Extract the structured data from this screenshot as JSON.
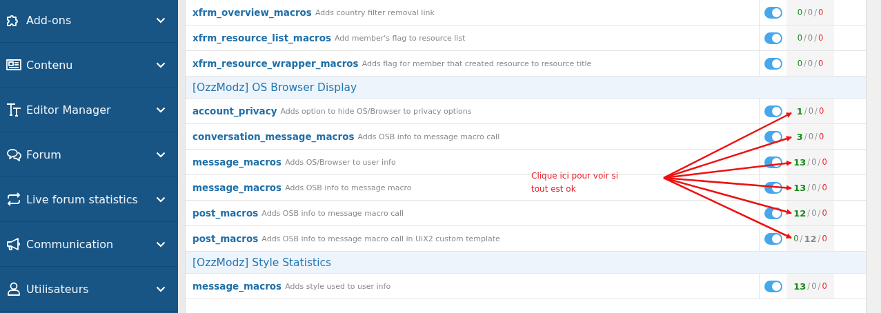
{
  "sidebar": {
    "items": [
      {
        "label": "Add-ons",
        "expanded": false
      },
      {
        "label": "Contenu",
        "expanded": false
      },
      {
        "label": "Editor Manager",
        "expanded": false
      },
      {
        "label": "Forum",
        "expanded": false
      },
      {
        "label": "Live forum statistics",
        "expanded": false
      },
      {
        "label": "Communication",
        "expanded": false
      },
      {
        "label": "Utilisateurs",
        "expanded": false
      }
    ]
  },
  "table": {
    "separator": "/",
    "sections": [
      {
        "rows": [
          {
            "name": "xfrm_overview_macros",
            "description": "Adds country filter removal link",
            "enabled": true,
            "counts": [
              {
                "text": "0",
                "bold": false
              },
              {
                "text": "0",
                "bold": false
              },
              {
                "text": "0",
                "bold": false
              }
            ]
          },
          {
            "name": "xfrm_resource_list_macros",
            "description": "Add member's flag to resource list",
            "enabled": true,
            "counts": [
              {
                "text": "0",
                "bold": false
              },
              {
                "text": "0",
                "bold": false
              },
              {
                "text": "0",
                "bold": false
              }
            ]
          },
          {
            "name": "xfrm_resource_wrapper_macros",
            "description": "Adds flag for member that created resource to resource title",
            "enabled": true,
            "counts": [
              {
                "text": "0",
                "bold": false
              },
              {
                "text": "0",
                "bold": false
              },
              {
                "text": "0",
                "bold": false
              }
            ]
          }
        ]
      },
      {
        "title": "[OzzModz] OS Browser Display",
        "rows": [
          {
            "name": "account_privacy",
            "description": "Adds option to hide OS/Browser to privacy options",
            "enabled": true,
            "counts": [
              {
                "text": "1",
                "bold": true
              },
              {
                "text": "0",
                "bold": false
              },
              {
                "text": "0",
                "bold": false
              }
            ]
          },
          {
            "name": "conversation_message_macros",
            "description": "Adds OSB info to message macro call",
            "enabled": true,
            "counts": [
              {
                "text": "3",
                "bold": true
              },
              {
                "text": "0",
                "bold": false
              },
              {
                "text": "0",
                "bold": false
              }
            ]
          },
          {
            "name": "message_macros",
            "description": "Adds OS/Browser to user info",
            "enabled": true,
            "counts": [
              {
                "text": "13",
                "bold": true
              },
              {
                "text": "0",
                "bold": false
              },
              {
                "text": "0",
                "bold": false
              }
            ]
          },
          {
            "name": "message_macros",
            "description": "Adds OSB info to message macro",
            "enabled": true,
            "counts": [
              {
                "text": "13",
                "bold": true
              },
              {
                "text": "0",
                "bold": false
              },
              {
                "text": "0",
                "bold": false
              }
            ]
          },
          {
            "name": "post_macros",
            "description": "Adds OSB info to message macro call",
            "enabled": true,
            "counts": [
              {
                "text": "12",
                "bold": true
              },
              {
                "text": "0",
                "bold": false
              },
              {
                "text": "0",
                "bold": false
              }
            ]
          },
          {
            "name": "post_macros",
            "description": "Adds OSB info to message macro call in UiX2 custom template",
            "enabled": true,
            "counts": [
              {
                "text": "0",
                "bold": false
              },
              {
                "text": "12",
                "bold": true
              },
              {
                "text": "0",
                "bold": false
              }
            ]
          }
        ]
      },
      {
        "title": "[OzzModz] Style Statistics",
        "rows": [
          {
            "name": "message_macros",
            "description": "Adds style used to user info",
            "enabled": true,
            "counts": [
              {
                "text": "13",
                "bold": true
              },
              {
                "text": "0",
                "bold": false
              },
              {
                "text": "0",
                "bold": false
              }
            ]
          }
        ]
      }
    ]
  },
  "annotation": {
    "lines": [
      "Clique ici pour voir si",
      "tout est ok"
    ]
  }
}
